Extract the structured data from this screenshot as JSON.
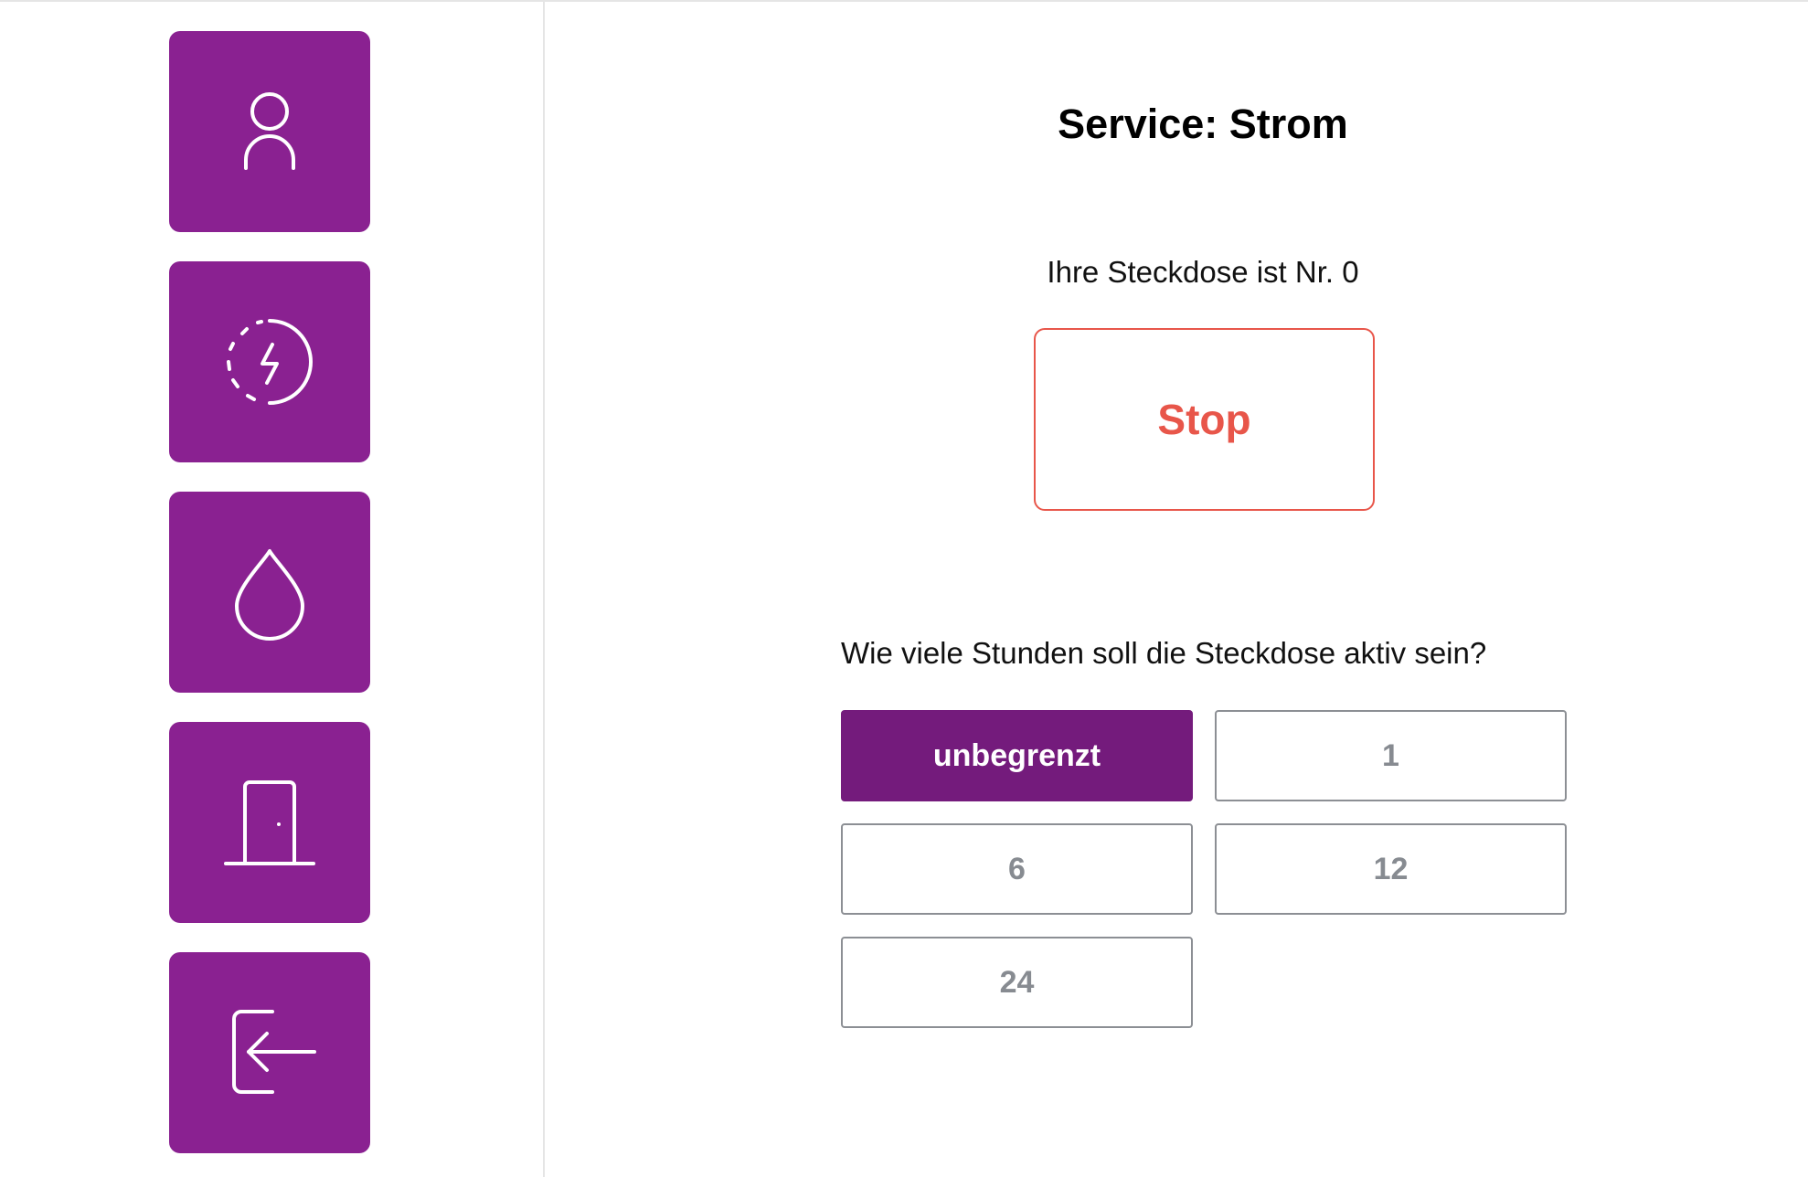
{
  "sidebar": {
    "items": [
      {
        "icon": "user-icon"
      },
      {
        "icon": "power-icon"
      },
      {
        "icon": "water-drop-icon"
      },
      {
        "icon": "door-icon"
      },
      {
        "icon": "login-icon"
      }
    ],
    "button_color": "#8a2191"
  },
  "main": {
    "title": "Service: Strom",
    "outlet_text": "Ihre Steckdose ist Nr. 0",
    "stop_label": "Stop",
    "stop_color": "#e8564a",
    "question": "Wie viele Stunden soll die Steckdose aktiv sein?",
    "duration_options": [
      "unbegrenzt",
      "1",
      "6",
      "12",
      "24"
    ],
    "selected_option": "unbegrenzt",
    "selected_color": "#741b7c"
  }
}
